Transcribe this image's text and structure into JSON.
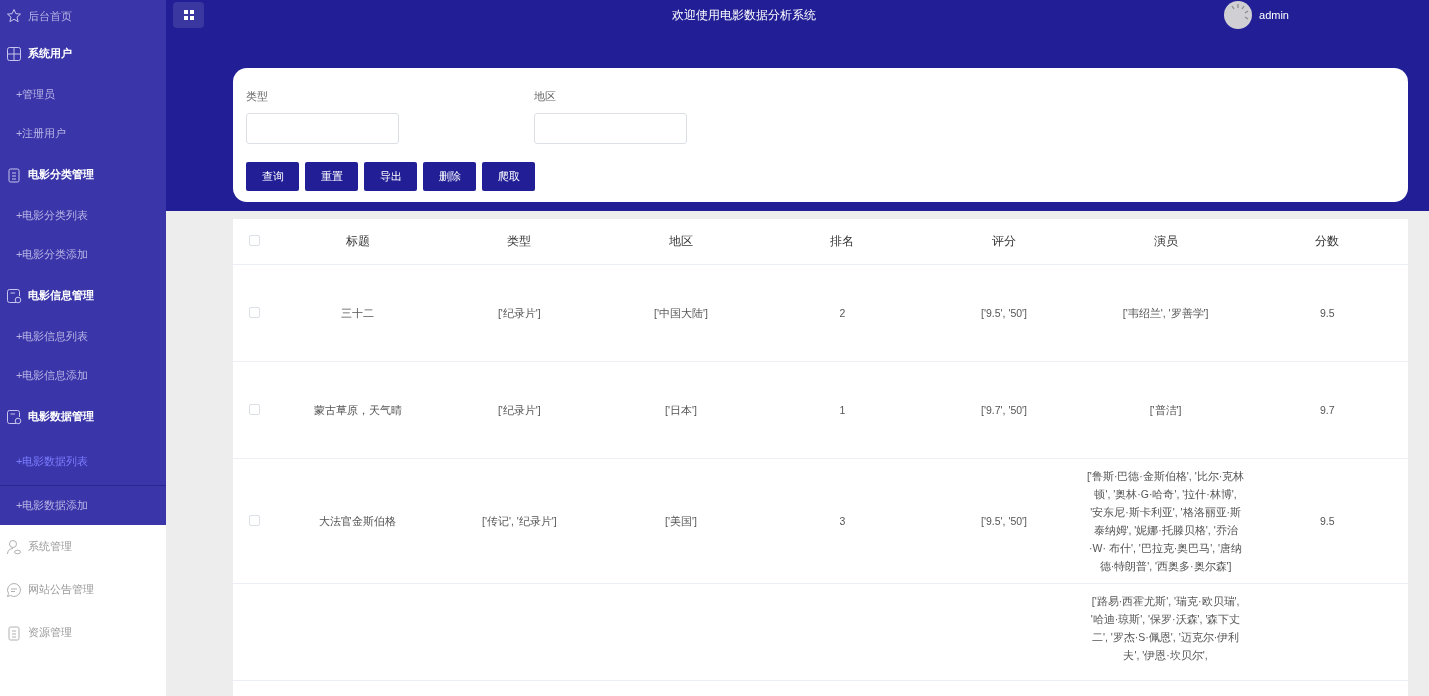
{
  "sidebar": {
    "menu": [
      {
        "label": "后台首页",
        "expanded": false
      },
      {
        "label": "系统用户",
        "expanded": true,
        "children": [
          {
            "label": "+管理员",
            "selected": false
          },
          {
            "label": "+注册用户",
            "selected": false
          }
        ]
      },
      {
        "label": "电影分类管理",
        "expanded": true,
        "children": [
          {
            "label": "+电影分类列表",
            "selected": false
          },
          {
            "label": "+电影分类添加",
            "selected": false
          }
        ]
      },
      {
        "label": "电影信息管理",
        "expanded": true,
        "children": [
          {
            "label": "+电影信息列表",
            "selected": false
          },
          {
            "label": "+电影信息添加",
            "selected": false
          }
        ]
      },
      {
        "label": "电影数据管理",
        "expanded": true,
        "children": [
          {
            "label": "+电影数据列表",
            "selected": true
          },
          {
            "label": "+电影数据添加",
            "selected": false
          }
        ]
      },
      {
        "label": "系统管理",
        "expanded": false
      },
      {
        "label": "网站公告管理",
        "expanded": false
      },
      {
        "label": "资源管理",
        "expanded": false
      }
    ]
  },
  "header": {
    "title": "欢迎使用电影数据分析系统",
    "user": "admin"
  },
  "search": {
    "fields": [
      {
        "label": "类型"
      },
      {
        "label": "地区"
      }
    ],
    "buttons": [
      "查询",
      "重置",
      "导出",
      "删除",
      "爬取"
    ]
  },
  "table": {
    "select_all": {
      "checked": false
    },
    "columns": [
      "标题",
      "类型",
      "地区",
      "排名",
      "评分",
      "演员",
      "分数"
    ],
    "rows": [
      {
        "checked": false,
        "cells": [
          "三十二",
          "['纪录片']",
          "['中国大陆']",
          "2",
          "['9.5', '50']",
          "['韦绍兰', '罗善学']",
          "9.5"
        ]
      },
      {
        "checked": false,
        "cells": [
          "蒙古草原，天气晴",
          "['纪录片']",
          "['日本']",
          "1",
          "['9.7', '50']",
          "['普洁']",
          "9.7"
        ]
      },
      {
        "checked": false,
        "cells": [
          "大法官金斯伯格",
          "['传记', '纪录片']",
          "['美国']",
          "3",
          "['9.5', '50']",
          "['鲁斯·巴德·金斯伯格', '比尔·克林顿', '奥林·G·哈奇', '拉什·林博', '安东尼·斯卡利亚', '格洛丽亚·斯泰纳姆', '妮娜·托滕贝格', '乔治·W· 布什', '巴拉克·奥巴马', '唐纳德·特朗普', '西奥多·奥尔森']",
          "9.5"
        ]
      },
      {
        "cells": [
          "",
          "",
          "",
          "",
          "",
          "['路易·西霍尤斯', '瑞克·欧贝瑞', '哈迪·琼斯', '保罗·沃森', '森下丈二', '罗杰·S·佩恩', '迈克尔·伊利夫', '伊恩·坎贝尔',",
          ""
        ]
      }
    ]
  }
}
